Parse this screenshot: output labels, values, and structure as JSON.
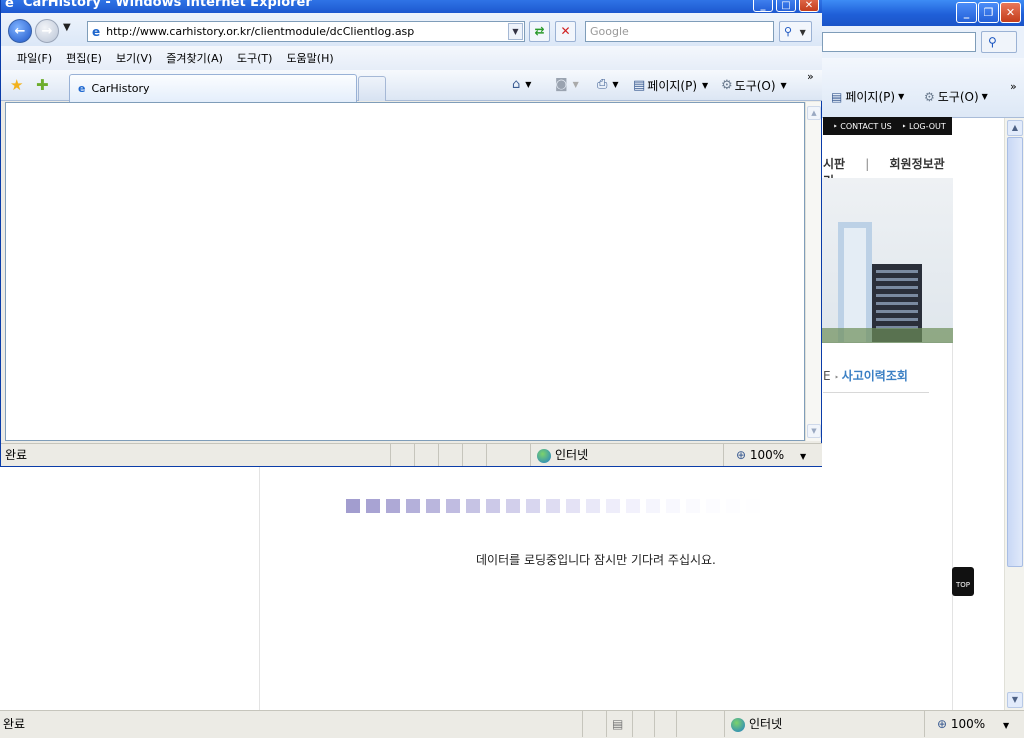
{
  "popup": {
    "title": "CarHistory - Windows Internet Explorer",
    "url": "http://www.carhistory.or.kr/clientmodule/dcClientlog.asp",
    "search_placeholder": "Google",
    "menu": [
      "파일(F)",
      "편집(E)",
      "보기(V)",
      "즐겨찾기(A)",
      "도구(T)",
      "도움말(H)"
    ],
    "tab_label": "CarHistory",
    "commands": {
      "page": "페이지(P)",
      "tools": "도구(O)"
    },
    "status": {
      "text": "완료",
      "zone": "인터넷",
      "zoom": "100%"
    }
  },
  "background": {
    "search_placeholder": "",
    "commands": {
      "page": "페이지(P)",
      "tools": "도구(O)"
    },
    "top_nav": [
      "CONTACT US",
      "LOG-OUT"
    ],
    "menu": [
      "시판",
      "회원정보관리"
    ],
    "breadcrumb": {
      "prefix": "E",
      "current": "사고이력조회"
    },
    "loading_message": "데이터를 로딩중입니다 잠시만 기다려 주십시요.",
    "top_button": "TOP",
    "status": {
      "text": "완료",
      "zone": "인터넷",
      "zoom": "100%"
    }
  },
  "progress_colors": [
    "#a29dcf",
    "#a8a3d3",
    "#aea9d6",
    "#b4b0da",
    "#bab6dd",
    "#c0bce1",
    "#c6c3e4",
    "#ccc9e8",
    "#d2cfeb",
    "#d8d6ef",
    "#dedcf2",
    "#e4e2f5",
    "#e9e8f8",
    "#eeedfa",
    "#f2f1fc",
    "#f5f5fd",
    "#f8f8fe",
    "#fafafe",
    "#fcfcff",
    "#fdfdff",
    "#fefeff",
    "#ffffff",
    "#ffffff",
    "#ffffff"
  ],
  "icons": {
    "back": "arrow-left-icon",
    "forward": "arrow-right-icon",
    "favorites": "star-icon",
    "home": "home-icon",
    "rss": "rss-icon",
    "print": "print-icon",
    "globe": "globe-icon",
    "zoom": "magnifier-icon"
  }
}
